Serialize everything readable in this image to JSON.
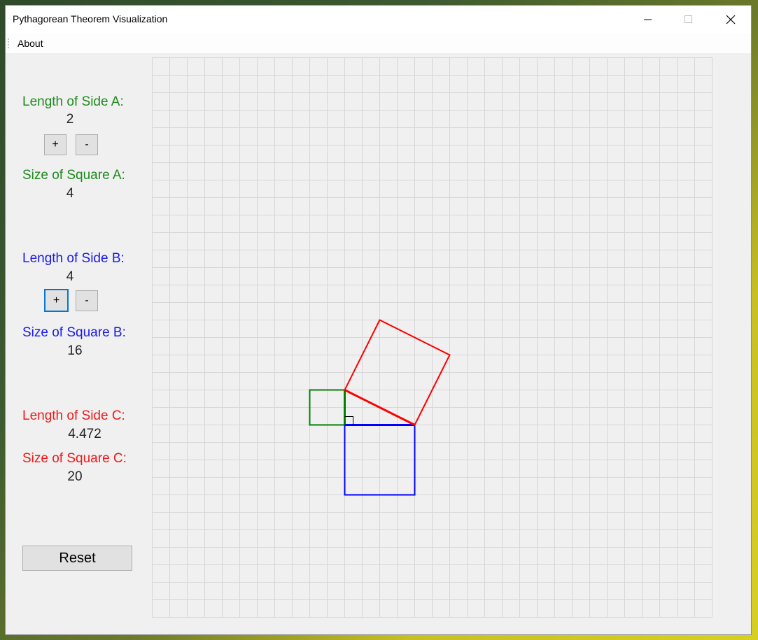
{
  "window": {
    "title": "Pythagorean Theorem Visualization"
  },
  "menu": {
    "about": "About"
  },
  "sideA": {
    "length_label": "Length of Side A:",
    "length": "2",
    "square_label": "Size of Square A:",
    "square": "4",
    "plus": "+",
    "minus": "-"
  },
  "sideB": {
    "length_label": "Length of Side B:",
    "length": "4",
    "square_label": "Size of Square B:",
    "square": "16",
    "plus": "+",
    "minus": "-"
  },
  "sideC": {
    "length_label": "Length of Side C:",
    "length": "4.472",
    "square_label": "Size of Square C:",
    "square": "20"
  },
  "reset_label": "Reset",
  "colors": {
    "a": "#008000",
    "b": "#0000ff",
    "c": "#ff0000",
    "grid": "#d6d6d6",
    "focus": "#0078d7"
  },
  "grid": {
    "cols": 32,
    "rows": 32
  },
  "triangle": {
    "a": 2,
    "b": 4,
    "right_angle_cell": [
      11,
      21
    ]
  }
}
